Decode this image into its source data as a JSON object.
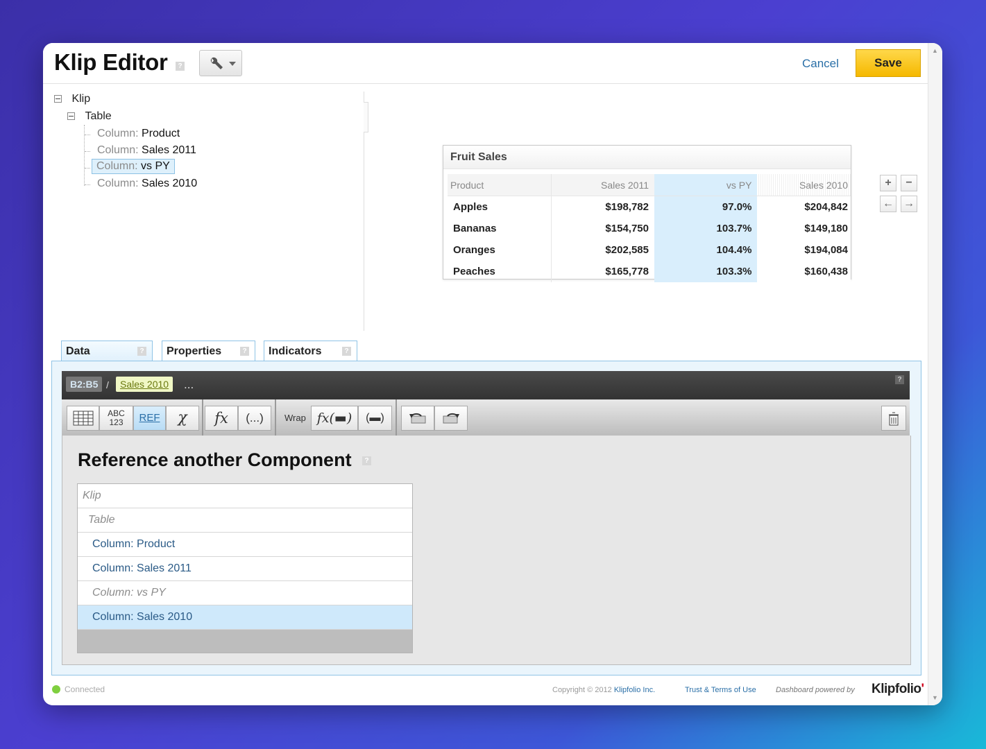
{
  "header": {
    "title": "Klip Editor",
    "help": "?",
    "cancel": "Cancel",
    "save": "Save"
  },
  "tree": {
    "root": "Klip",
    "table": "Table",
    "columns": [
      {
        "key": "Column:",
        "value": "Product"
      },
      {
        "key": "Column:",
        "value": "Sales 2011"
      },
      {
        "key": "Column:",
        "value": "vs PY"
      },
      {
        "key": "Column:",
        "value": "Sales 2010"
      }
    ]
  },
  "widget": {
    "title": "Fruit Sales",
    "headers": [
      "Product",
      "Sales 2011",
      "vs PY",
      "Sales 2010"
    ],
    "rows": [
      [
        "Apples",
        "$198,782",
        "97.0%",
        "$204,842"
      ],
      [
        "Bananas",
        "$154,750",
        "103.7%",
        "$149,180"
      ],
      [
        "Oranges",
        "$202,585",
        "104.4%",
        "$194,084"
      ],
      [
        "Peaches",
        "$165,778",
        "103.3%",
        "$160,438"
      ]
    ]
  },
  "tabs": [
    "Data",
    "Properties",
    "Indicators"
  ],
  "formula_bar": {
    "range": "B2:B5",
    "separator": "/",
    "selected": "Sales 2010",
    "more": "..."
  },
  "toolbar": {
    "abc": "ABC",
    "num": "123",
    "ref": "REF",
    "fx": "fx",
    "paren": "(...)",
    "wrap": "Wrap",
    "wrap_fx": "fx(▬)",
    "wrap_paren": "(▬)"
  },
  "reference": {
    "title": "Reference another Component",
    "items": [
      {
        "label": "Klip",
        "state": "disabled"
      },
      {
        "label": "Table",
        "state": "disabled"
      },
      {
        "label": "Column: Product",
        "state": "normal"
      },
      {
        "label": "Column: Sales 2011",
        "state": "normal"
      },
      {
        "label": "Column: vs PY",
        "state": "disabled"
      },
      {
        "label": "Column: Sales 2010",
        "state": "selected"
      }
    ]
  },
  "footer": {
    "status": "Connected",
    "copyright": "Copyright © 2012",
    "company": "Klipfolio Inc.",
    "terms": "Trust & Terms of Use",
    "powered": "Dashboard powered by",
    "brand": "Klipfolio"
  },
  "colors": {
    "accent": "#2a6fa7",
    "save": "#f5b800",
    "selection": "#d9eefc",
    "connected": "#7fcf3f"
  }
}
